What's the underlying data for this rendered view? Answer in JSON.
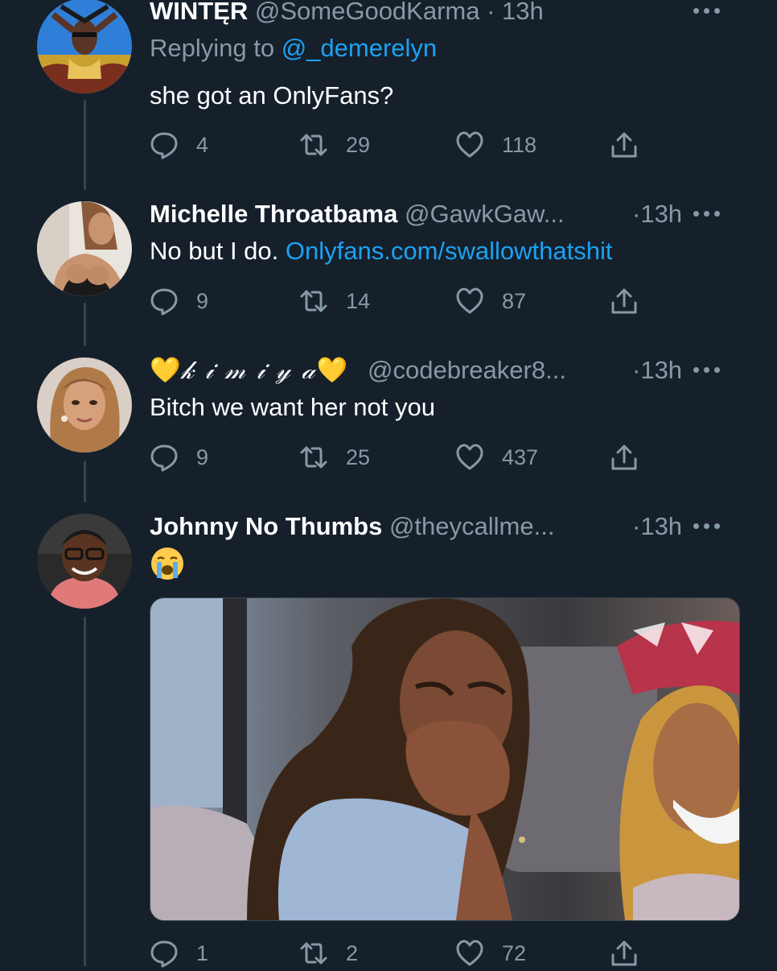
{
  "thread": [
    {
      "display_name": "WINTĘR",
      "handle": "@SomeGoodKarma",
      "time": "· 13h",
      "replying_label": "Replying to",
      "replying_to": "@_demerelyn",
      "text": "she got an OnlyFans?",
      "replies": "4",
      "retweets": "29",
      "likes": "118"
    },
    {
      "display_name": "Michelle Throatbama",
      "handle": "@GawkGaw...",
      "time": "·13h",
      "text": "No but I do.",
      "link": "Onlyfans.com/swallowthatshit",
      "replies": "9",
      "retweets": "14",
      "likes": "87"
    },
    {
      "display_name_heart_left": "💛",
      "display_name": "𝓀 𝒾 𝓂 𝒾 𝓎 𝒶",
      "display_name_heart_right": "💛",
      "handle": "@codebreaker8...",
      "time": "·13h",
      "text": "Bitch we want her not you",
      "replies": "9",
      "retweets": "25",
      "likes": "437"
    },
    {
      "display_name": "Johnny No Thumbs",
      "handle": "@theycallme...",
      "time": "·13h",
      "emoji_name": "loudly-crying-face",
      "media_description_icon": "gif-image",
      "replies": "1",
      "retweets": "2",
      "likes": "72"
    }
  ],
  "icons": {
    "reply": "speech-bubble-icon",
    "retweet": "retweet-icon",
    "like": "heart-icon",
    "share": "share-icon",
    "more": "more-dots-icon"
  },
  "colors": {
    "background": "#15202b",
    "secondary_text": "#8899a6",
    "link": "#1da1f2",
    "thread_line": "#38444d"
  }
}
